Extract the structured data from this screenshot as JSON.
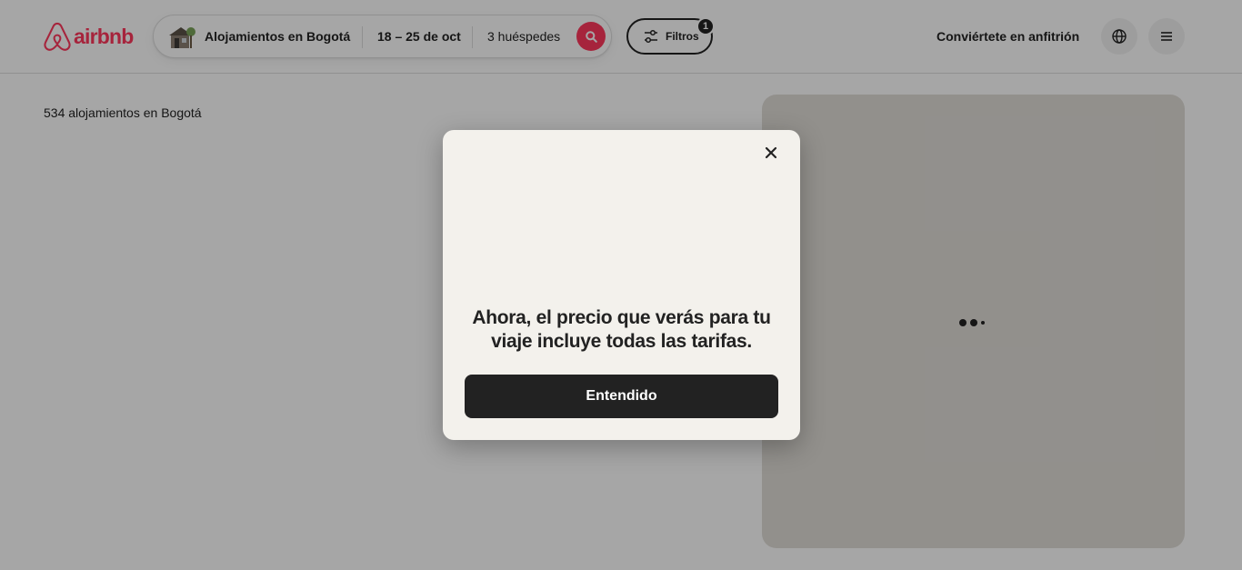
{
  "header": {
    "logo_text": "airbnb",
    "search": {
      "location": "Alojamientos en Bogotá",
      "dates": "18 – 25 de oct",
      "guests": "3 huéspedes",
      "search_icon": "search-icon",
      "thumbnail_icon": "house-icon"
    },
    "filters": {
      "label": "Filtros",
      "count": "1",
      "icon": "sliders-icon"
    },
    "host_link": "Conviértete en anfitrión",
    "globe_icon": "globe-icon",
    "menu_icon": "menu-icon"
  },
  "results": {
    "count_text": "534 alojamientos en Bogotá"
  },
  "map": {
    "loading_icon": "loading-dots-icon"
  },
  "modal": {
    "close_icon": "close-icon",
    "heading": "Ahora, el precio que verás para tu viaje incluye todas las tarifas.",
    "confirm_label": "Entendido"
  },
  "colors": {
    "brand": "#ff385c",
    "text": "#222222",
    "modal_bg": "#f3f1ec",
    "button_dark": "#222222"
  }
}
